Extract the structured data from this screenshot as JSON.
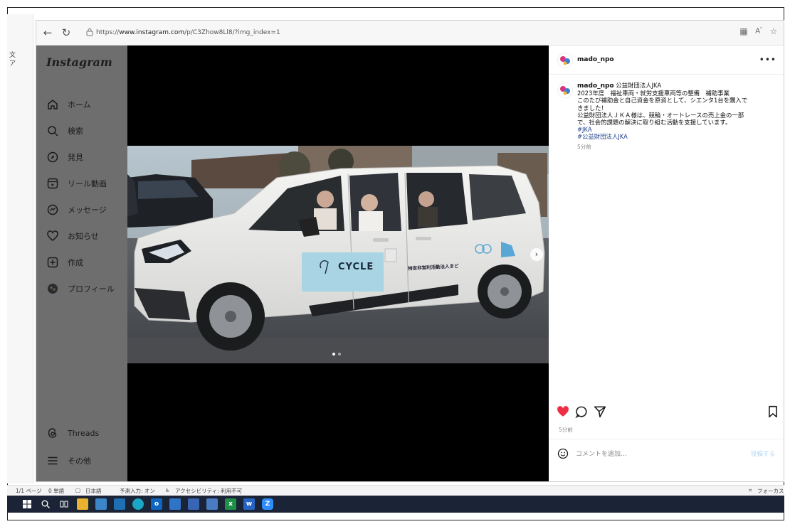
{
  "browser": {
    "url_prefix": "https://",
    "url_host": "www.instagram.com",
    "url_path": "/p/C3Zhow8Ll8/?img_index=1"
  },
  "sidebar": {
    "logo": "Instagram",
    "items": [
      {
        "label": "ホーム",
        "icon": "home-icon"
      },
      {
        "label": "検索",
        "icon": "search-icon"
      },
      {
        "label": "発見",
        "icon": "compass-icon"
      },
      {
        "label": "リール動画",
        "icon": "reels-icon"
      },
      {
        "label": "メッセージ",
        "icon": "messenger-icon"
      },
      {
        "label": "お知らせ",
        "icon": "heart-icon"
      },
      {
        "label": "作成",
        "icon": "plus-square-icon"
      },
      {
        "label": "プロフィール",
        "icon": "profile-avatar-icon"
      }
    ],
    "bottom": [
      {
        "label": "Threads",
        "icon": "threads-icon"
      },
      {
        "label": "その他",
        "icon": "menu-icon"
      }
    ]
  },
  "post": {
    "username": "mado_npo",
    "caption_user": "mado_npo",
    "caption_lines": [
      "公益財団法人JKA",
      "2023年度　福祉車両・就労支援車両等の整備　補助事業",
      "このたび補助金と自己資金を原資として、シエンタ1台を購入で",
      "きました！",
      "公益財団法人ＪＫＡ様は、競輪・オートレースの売上金の一部",
      "で、社会的課題の解決に取り組む活動を支援しています。"
    ],
    "hashtags": [
      "#JKA",
      "#公益財団法人JKA"
    ],
    "caption_time": "5分前",
    "time": "5分前",
    "comment_placeholder": "コメントを追加...",
    "post_label": "投稿する",
    "car_sticker": "CYCLE",
    "car_door_text": "特定非営利活動法人まど"
  },
  "statusbar": {
    "page": "1/1 ページ",
    "words": "0 単語",
    "language": "日本語",
    "ime": "予測入力: オン",
    "accessibility": "アクセシビリティ: 利用不可",
    "focus": "フォーカス"
  },
  "colors": {
    "like_red": "#ed2e45",
    "taskbar": "#1b2436",
    "overlay": "#6e6e6e"
  }
}
